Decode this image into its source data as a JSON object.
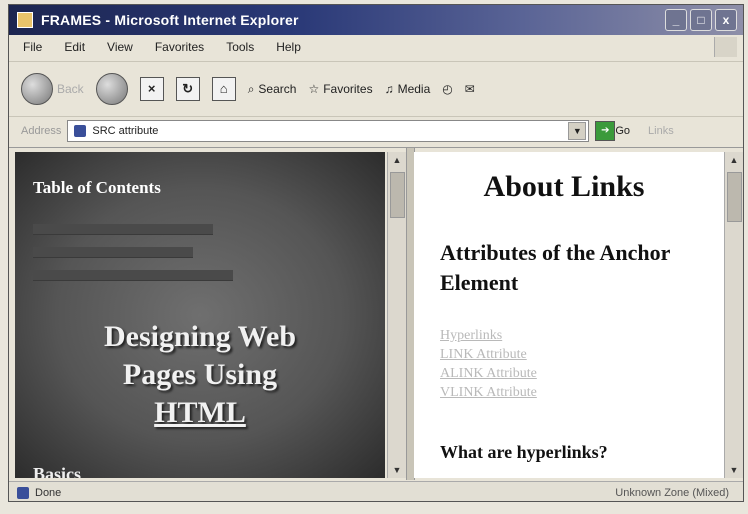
{
  "window": {
    "title": "FRAMES - Microsoft Internet Explorer",
    "buttons": {
      "minimize": "_",
      "maximize": "□",
      "close": "x"
    }
  },
  "menu": [
    "File",
    "Edit",
    "View",
    "Favorites",
    "Tools",
    "Help"
  ],
  "toolbar": {
    "back": "Back",
    "forward": "",
    "search": "Search",
    "favorites": "Favorites",
    "media": "Media"
  },
  "address": {
    "label": "Address",
    "value": "SRC attribute",
    "go": "Go",
    "links": "Links"
  },
  "left_frame": {
    "toc_title": "Table of Contents",
    "title_line1": "Designing Web",
    "title_line2": "Pages Using",
    "title_line3": "HTML",
    "bottom_text": "Basics"
  },
  "right_frame": {
    "heading": "About Links",
    "subheading": "Attributes of the Anchor Element",
    "links": [
      "Hyperlinks",
      "LINK Attribute",
      "ALINK Attribute",
      "VLINK Attribute"
    ],
    "question": "What are hyperlinks?"
  },
  "status": {
    "text": "Done",
    "zone": "Unknown Zone (Mixed)"
  }
}
